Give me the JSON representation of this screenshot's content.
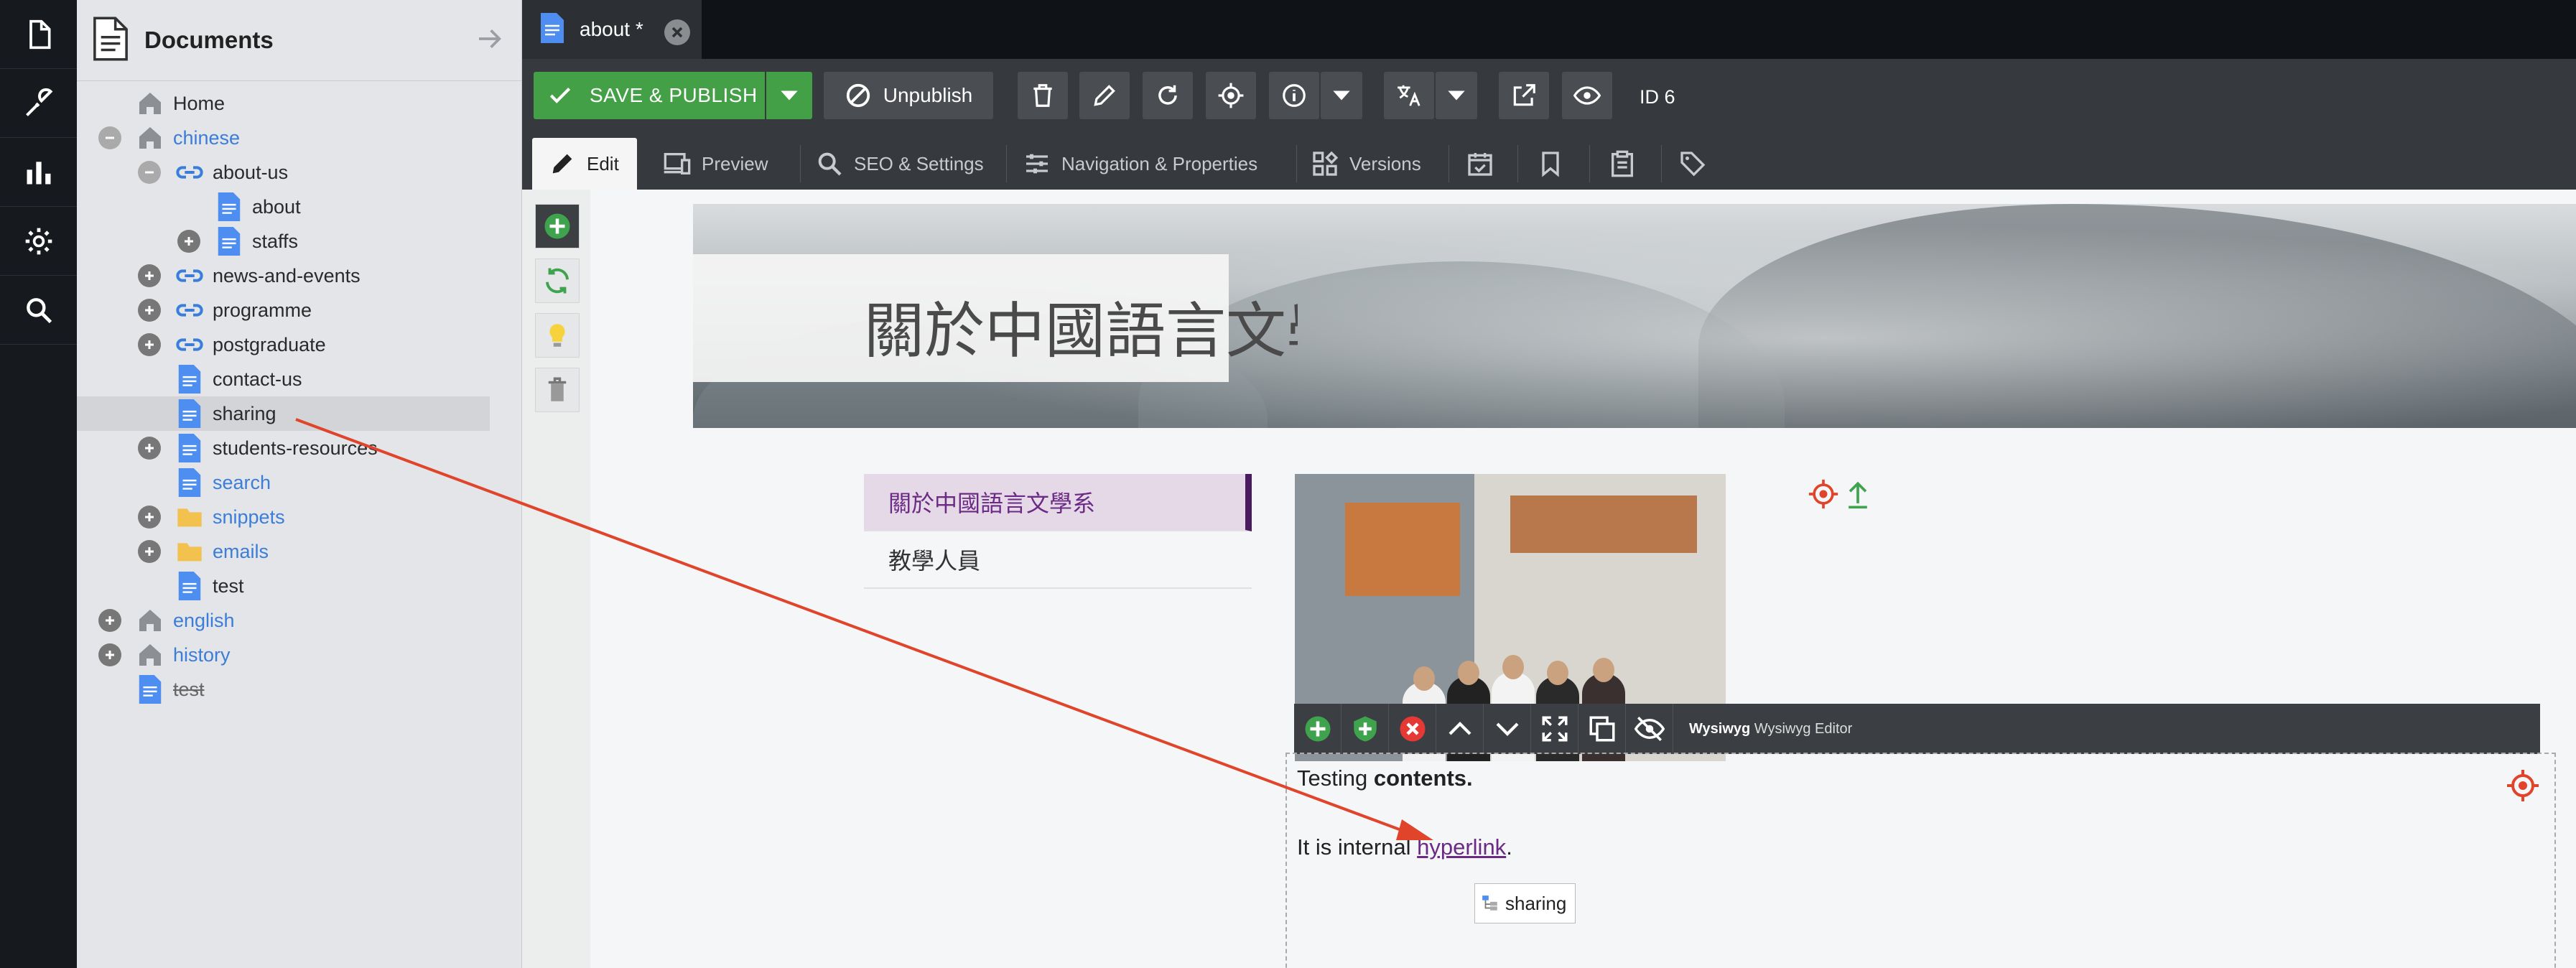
{
  "rail": {
    "items": [
      "documents-icon",
      "tools-icon",
      "analytics-icon",
      "settings-icon",
      "search-icon"
    ]
  },
  "tree": {
    "title": "Documents",
    "nodes": [
      {
        "label": "Home",
        "type": "home",
        "depth": 0,
        "expander": "none",
        "style": "black"
      },
      {
        "label": "chinese",
        "type": "home",
        "depth": 0,
        "expander": "minus",
        "style": "blue"
      },
      {
        "label": "about-us",
        "type": "link",
        "depth": 1,
        "expander": "minus",
        "style": "black"
      },
      {
        "label": "about",
        "type": "page",
        "depth": 2,
        "expander": "none",
        "style": "black"
      },
      {
        "label": "staffs",
        "type": "page",
        "depth": 2,
        "expander": "plus",
        "style": "black"
      },
      {
        "label": "news-and-events",
        "type": "link",
        "depth": 1,
        "expander": "plus",
        "style": "black"
      },
      {
        "label": "programme",
        "type": "link",
        "depth": 1,
        "expander": "plus",
        "style": "black"
      },
      {
        "label": "postgraduate",
        "type": "link",
        "depth": 1,
        "expander": "plus",
        "style": "black"
      },
      {
        "label": "contact-us",
        "type": "page",
        "depth": 1,
        "expander": "none",
        "style": "black"
      },
      {
        "label": "sharing",
        "type": "page",
        "depth": 1,
        "expander": "none",
        "style": "black",
        "selected": true
      },
      {
        "label": "students-resources",
        "type": "page",
        "depth": 1,
        "expander": "plus",
        "style": "black"
      },
      {
        "label": "search",
        "type": "page",
        "depth": 1,
        "expander": "none",
        "style": "blue"
      },
      {
        "label": "snippets",
        "type": "folder",
        "depth": 1,
        "expander": "plus",
        "style": "blue"
      },
      {
        "label": "emails",
        "type": "folder",
        "depth": 1,
        "expander": "plus",
        "style": "blue"
      },
      {
        "label": "test",
        "type": "page",
        "depth": 1,
        "expander": "none",
        "style": "black"
      },
      {
        "label": "english",
        "type": "home",
        "depth": 0,
        "expander": "plus",
        "style": "blue"
      },
      {
        "label": "history",
        "type": "home",
        "depth": 0,
        "expander": "plus",
        "style": "blue"
      },
      {
        "label": "test",
        "type": "page",
        "depth": 0,
        "expander": "none",
        "style": "strike"
      }
    ]
  },
  "tabs": [
    {
      "label": "about *"
    }
  ],
  "toolbar": {
    "save_label": "SAVE & PUBLISH",
    "unpublish_label": "Unpublish",
    "id_label": "ID 6"
  },
  "subtabs": {
    "edit": "Edit",
    "preview": "Preview",
    "seo": "SEO & Settings",
    "navigation": "Navigation & Properties",
    "versions": "Versions"
  },
  "page": {
    "hero_title": "關於中國語言文學系",
    "sidenav": [
      "關於中國語言文學系",
      "教學人員"
    ]
  },
  "wysiwyg": {
    "label_bold": "Wysiwyg",
    "label_rest": " Wysiwyg Editor",
    "p1_text": "Testing ",
    "p1_bold": "contents.",
    "p2_text": "It is internal ",
    "p2_link": "hyperlink",
    "p2_end": ".",
    "tooltip": "sharing"
  },
  "colors": {
    "accent_green": "#43a047",
    "link_blue": "#3b7dd8",
    "nav_purple": "#6b2a84",
    "pin_red": "#e0452b"
  }
}
